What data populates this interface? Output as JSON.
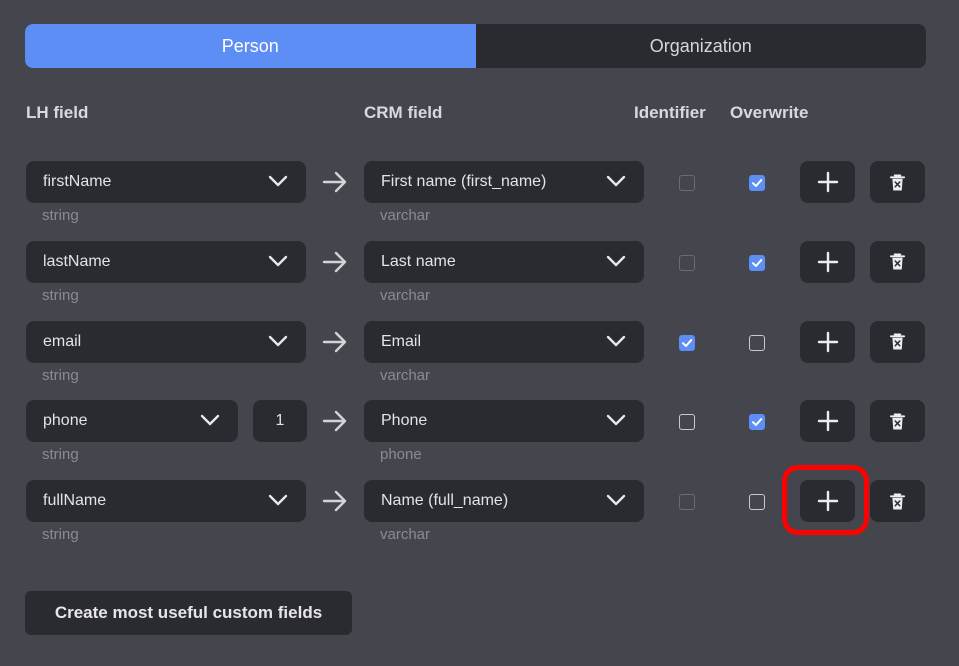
{
  "tabs": [
    {
      "label": "Person",
      "active": true
    },
    {
      "label": "Organization",
      "active": false
    }
  ],
  "headers": {
    "lh_field": "LH field",
    "crm_field": "CRM field",
    "identifier": "Identifier",
    "overwrite": "Overwrite"
  },
  "rows": [
    {
      "lh": "firstName",
      "lh_type": "string",
      "crm": "First name (first_name)",
      "crm_type": "varchar",
      "identifier": false,
      "identifier_enabled": false,
      "overwrite": true
    },
    {
      "lh": "lastName",
      "lh_type": "string",
      "crm": "Last name",
      "crm_type": "varchar",
      "identifier": false,
      "identifier_enabled": false,
      "overwrite": true
    },
    {
      "lh": "email",
      "lh_type": "string",
      "crm": "Email",
      "crm_type": "varchar",
      "identifier": true,
      "identifier_enabled": true,
      "overwrite": false
    },
    {
      "lh": "phone",
      "lh_type": "string",
      "index": "1",
      "crm": "Phone",
      "crm_type": "phone",
      "identifier": false,
      "identifier_enabled": true,
      "overwrite": true
    },
    {
      "lh": "fullName",
      "lh_type": "string",
      "crm": "Name (full_name)",
      "crm_type": "varchar",
      "identifier": false,
      "identifier_enabled": false,
      "overwrite": false
    }
  ],
  "create_button": "Create most useful custom fields",
  "colors": {
    "accent": "#5d8ef5",
    "background": "#45464d",
    "control": "#2a2b30",
    "highlight": "#ff0000"
  },
  "icons": {
    "dropdown": "chevron-down-icon",
    "mapping": "arrow-right-icon",
    "add": "plus-icon",
    "delete": "trash-icon"
  }
}
